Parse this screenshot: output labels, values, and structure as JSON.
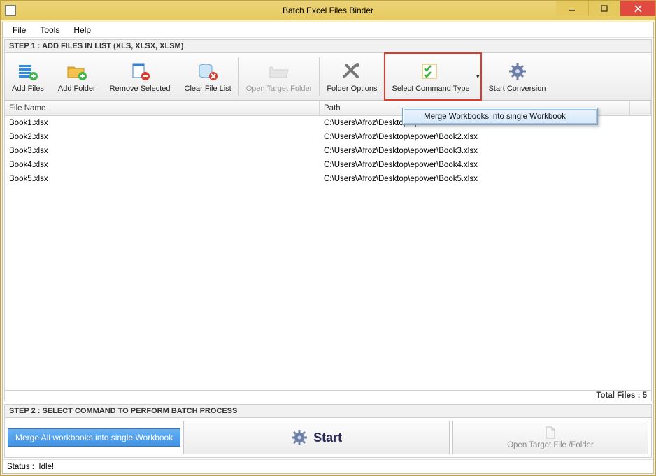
{
  "window": {
    "title": "Batch Excel Files Binder"
  },
  "menubar": {
    "file": "File",
    "tools": "Tools",
    "help": "Help"
  },
  "step1": {
    "header": "STEP 1 : ADD FILES IN LIST (XLS, XLSX, XLSM)"
  },
  "toolbar": {
    "add_files": "Add Files",
    "add_folder": "Add Folder",
    "remove_selected": "Remove Selected",
    "clear_list": "Clear File List",
    "open_target": "Open Target Folder",
    "folder_options": "Folder Options",
    "select_command": "Select Command Type",
    "start_conversion": "Start Conversion"
  },
  "dropdown": {
    "merge_option": "Merge Workbooks into single Workbook"
  },
  "grid": {
    "col_file": "File Name",
    "col_path": "Path",
    "rows": [
      {
        "file": "Book1.xlsx",
        "path": "C:\\Users\\Afroz\\Desktop\\epower\\Book1.xlsx"
      },
      {
        "file": "Book2.xlsx",
        "path": "C:\\Users\\Afroz\\Desktop\\epower\\Book2.xlsx"
      },
      {
        "file": "Book3.xlsx",
        "path": "C:\\Users\\Afroz\\Desktop\\epower\\Book3.xlsx"
      },
      {
        "file": "Book4.xlsx",
        "path": "C:\\Users\\Afroz\\Desktop\\epower\\Book4.xlsx"
      },
      {
        "file": "Book5.xlsx",
        "path": "C:\\Users\\Afroz\\Desktop\\epower\\Book5.xlsx"
      }
    ],
    "total_files": "Total Files : 5"
  },
  "step2": {
    "header": "STEP 2 : SELECT COMMAND TO PERFORM BATCH PROCESS",
    "selected_command": "Merge All workbooks into single Workbook",
    "start_label": "Start",
    "open_target_label": "Open Target File /Folder"
  },
  "statusbar": {
    "label": "Status  :",
    "value": "Idle!"
  }
}
